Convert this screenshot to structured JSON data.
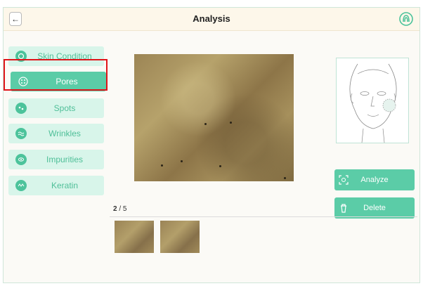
{
  "header": {
    "title": "Analysis",
    "back_label": "←"
  },
  "sidebar": {
    "items": [
      {
        "label": "Skin Condition",
        "icon": "skin-condition-icon",
        "active": false
      },
      {
        "label": "Pores",
        "icon": "pores-icon",
        "active": true
      },
      {
        "label": "Spots",
        "icon": "spots-icon",
        "active": false
      },
      {
        "label": "Wrinkles",
        "icon": "wrinkles-icon",
        "active": false
      },
      {
        "label": "Impurities",
        "icon": "impurities-icon",
        "active": false
      },
      {
        "label": "Keratin",
        "icon": "keratin-icon",
        "active": false
      }
    ]
  },
  "actions": {
    "analyze_label": "Analyze",
    "delete_label": "Delete"
  },
  "gallery": {
    "current": "2",
    "separator": "/",
    "total": "5",
    "thumbnail_count": 2
  },
  "colors": {
    "accent": "#5bcca7",
    "accent_light": "#d8f5ea",
    "highlight": "#e0141a"
  }
}
